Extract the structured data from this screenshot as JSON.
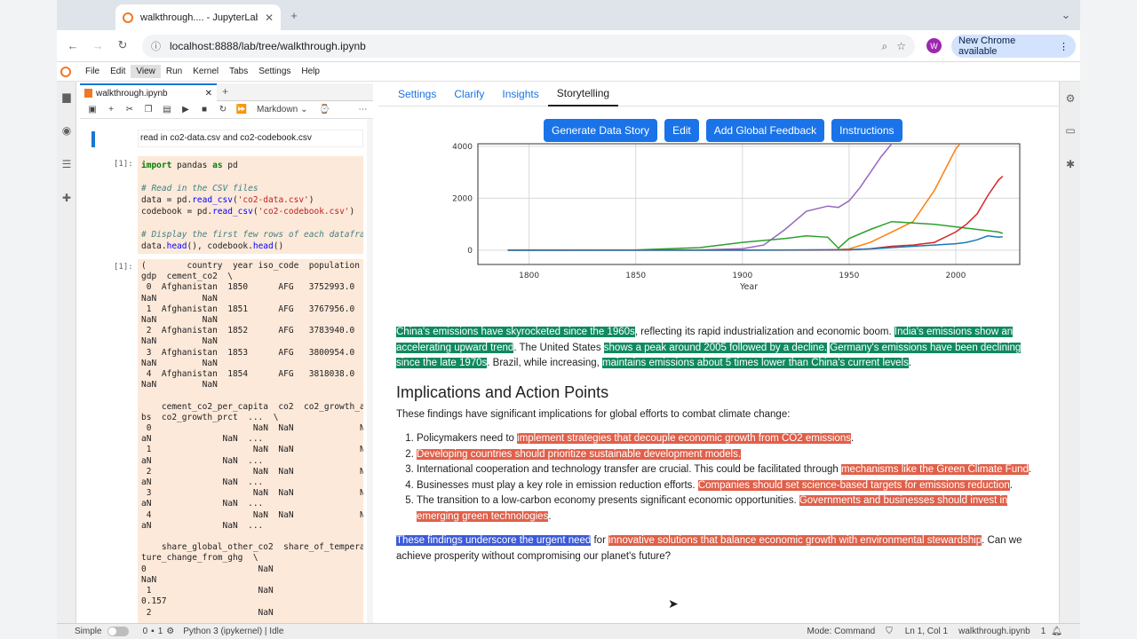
{
  "browser": {
    "tab_title": "walkthrough.... - JupyterLab",
    "new_tab": "+",
    "url": "localhost:8888/lab/tree/walkthrough.ipynb",
    "avatar_initial": "W",
    "new_chrome_label": "New Chrome available"
  },
  "menubar": {
    "items": [
      "File",
      "Edit",
      "View",
      "Run",
      "Kernel",
      "Tabs",
      "Settings",
      "Help"
    ]
  },
  "notebook": {
    "tab_label": "walkthrough.ipynb",
    "cell_type": "Markdown",
    "markdown_cell": "read in co2-data.csv and co2-codebook.csv",
    "in_prompt": "[1]:",
    "out_prompt": "[1]:",
    "code_lines": {
      "l1_kw": "import",
      "l1_rest": " pandas ",
      "l1_as": "as",
      "l1_end": " pd",
      "l3": "# Read in the CSV files",
      "l4_a": "data = pd.",
      "l4_fn": "read_csv",
      "l4_b": "(",
      "l4_str": "'co2-data.csv'",
      "l4_c": ")",
      "l5_a": "codebook = pd.",
      "l5_fn": "read_csv",
      "l5_b": "(",
      "l5_str": "'co2-codebook.csv'",
      "l5_c": ")",
      "l7": "# Display the first few rows of each datafram",
      "l8_a": "data.",
      "l8_fn": "head",
      "l8_b": "(), codebook.",
      "l8_fn2": "head",
      "l8_c": "()"
    },
    "output_text": "(        country  year iso_code  population  \ngdp  cement_co2  \\\n 0  Afghanistan  1850      AFG   3752993.0   \nNaN         NaN\n 1  Afghanistan  1851      AFG   3767956.0   \nNaN         NaN\n 2  Afghanistan  1852      AFG   3783940.0   \nNaN         NaN\n 3  Afghanistan  1853      AFG   3800954.0   \nNaN         NaN\n 4  Afghanistan  1854      AFG   3818038.0   \nNaN         NaN\n\n    cement_co2_per_capita  co2  co2_growth_a\nbs  co2_growth_prct  ...  \\\n 0                    NaN  NaN             N\naN              NaN  ...\n 1                    NaN  NaN             N\naN              NaN  ...\n 2                    NaN  NaN             N\naN              NaN  ...\n 3                    NaN  NaN             N\naN              NaN  ...\n 4                    NaN  NaN             N\naN              NaN  ...\n\n    share_global_other_co2  share_of_tempera\nture_change_from_ghg  \\\n0                      NaN\nNaN\n 1                     NaN\n0.157\n 2                     NaN"
  },
  "panel": {
    "tabs": [
      "Settings",
      "Clarify",
      "Insights",
      "Storytelling"
    ],
    "active_tab": "Storytelling",
    "buttons": {
      "generate": "Generate Data Story",
      "edit": "Edit",
      "feedback": "Add Global Feedback",
      "instructions": "Instructions"
    }
  },
  "chart_data": {
    "type": "line",
    "xlabel": "Year",
    "ylabel": "",
    "x_ticks": [
      1800,
      1850,
      1900,
      1950,
      2000
    ],
    "y_ticks": [
      0,
      2000,
      4000
    ],
    "xlim": [
      1776,
      2030
    ],
    "ylim": [
      -550,
      4100
    ],
    "grid": true,
    "series": [
      {
        "color": "#9467bd",
        "x": [
          1790,
          1850,
          1880,
          1900,
          1910,
          1920,
          1930,
          1940,
          1945,
          1950,
          1955,
          1960,
          1965,
          1970,
          1975
        ],
        "y": [
          0,
          3,
          10,
          60,
          200,
          800,
          1500,
          1700,
          1650,
          1900,
          2400,
          3000,
          3600,
          4100,
          4400
        ]
      },
      {
        "color": "#ff7f0e",
        "x": [
          1790,
          1900,
          1940,
          1950,
          1960,
          1970,
          1980,
          1990,
          2000,
          2002
        ],
        "y": [
          0,
          0,
          5,
          50,
          300,
          700,
          1100,
          2300,
          3900,
          4100
        ]
      },
      {
        "color": "#2ca02c",
        "x": [
          1790,
          1850,
          1880,
          1900,
          1920,
          1930,
          1940,
          1945,
          1950,
          1960,
          1970,
          1980,
          1990,
          2000,
          2010,
          2020,
          2022
        ],
        "y": [
          0,
          10,
          100,
          300,
          450,
          550,
          500,
          80,
          450,
          800,
          1100,
          1050,
          1000,
          900,
          800,
          700,
          650
        ]
      },
      {
        "color": "#d62728",
        "x": [
          1790,
          1900,
          1950,
          1960,
          1970,
          1980,
          1990,
          2000,
          2005,
          2010,
          2015,
          2020,
          2022
        ],
        "y": [
          0,
          0,
          10,
          60,
          150,
          200,
          300,
          700,
          1000,
          1400,
          2100,
          2700,
          2850
        ]
      },
      {
        "color": "#1f77b4",
        "x": [
          1790,
          1900,
          1950,
          1960,
          1970,
          1980,
          1990,
          2000,
          2005,
          2010,
          2015,
          2020,
          2022
        ],
        "y": [
          0,
          0,
          20,
          50,
          100,
          150,
          200,
          250,
          300,
          400,
          550,
          500,
          520
        ]
      }
    ]
  },
  "story": {
    "p1": {
      "s1": "China's emissions have skyrocketed since the 1960s",
      "t1": ", reflecting its rapid industrialization and economic boom. ",
      "s2": "India's emissions show an accelerating upward trend",
      "t2": ". The United States ",
      "s3": "shows a peak around 2005 followed by a decline.",
      "t3": " ",
      "s4": "Germany's emissions have been declining since the late 1970s",
      "t4": ". Brazil, while increasing, ",
      "s5": "maintains emissions about 5 times lower than China's current levels",
      "t5": "."
    },
    "heading": "Implications and Action Points",
    "intro": "These findings have significant implications for global efforts to combat climate change:",
    "items": [
      {
        "pre": "Policymakers need to ",
        "hl": "implement strategies that decouple economic growth from CO2 emissions",
        "post": "."
      },
      {
        "pre": "",
        "hl": "Developing countries should prioritize sustainable development models.",
        "post": ""
      },
      {
        "pre": "International cooperation and technology transfer are crucial. This could be facilitated through ",
        "hl": "mechanisms like the Green Climate Fund",
        "post": "."
      },
      {
        "pre": "Businesses must play a key role in emission reduction efforts. ",
        "hl": "Companies should set science-based targets for emissions reduction",
        "post": "."
      },
      {
        "pre": "The transition to a low-carbon economy presents significant economic opportunities. ",
        "hl": "Governments and businesses should invest in emerging green technologies",
        "post": "."
      }
    ],
    "conclusion": {
      "s1": "These findings underscore the urgent need",
      "t1": " for ",
      "s2": "innovative solutions that balance economic growth with environmental stewardship",
      "t2": ". Can we achieve prosperity without compromising our planet's future?"
    }
  },
  "status": {
    "mode_toggle": "Simple",
    "count_a": "0",
    "count_b": "1",
    "kernel": "Python 3 (ipykernel) | Idle",
    "mode": "Mode: Command",
    "cursor": "Ln 1, Col 1",
    "file": "walkthrough.ipynb",
    "notif": "1"
  },
  "colors": {
    "accent": "#1a73e8",
    "highlight_green": "#0f8a5f",
    "highlight_red": "#e0604a",
    "highlight_blue": "#3b5bdb",
    "cell_bg": "#fde9d9"
  }
}
